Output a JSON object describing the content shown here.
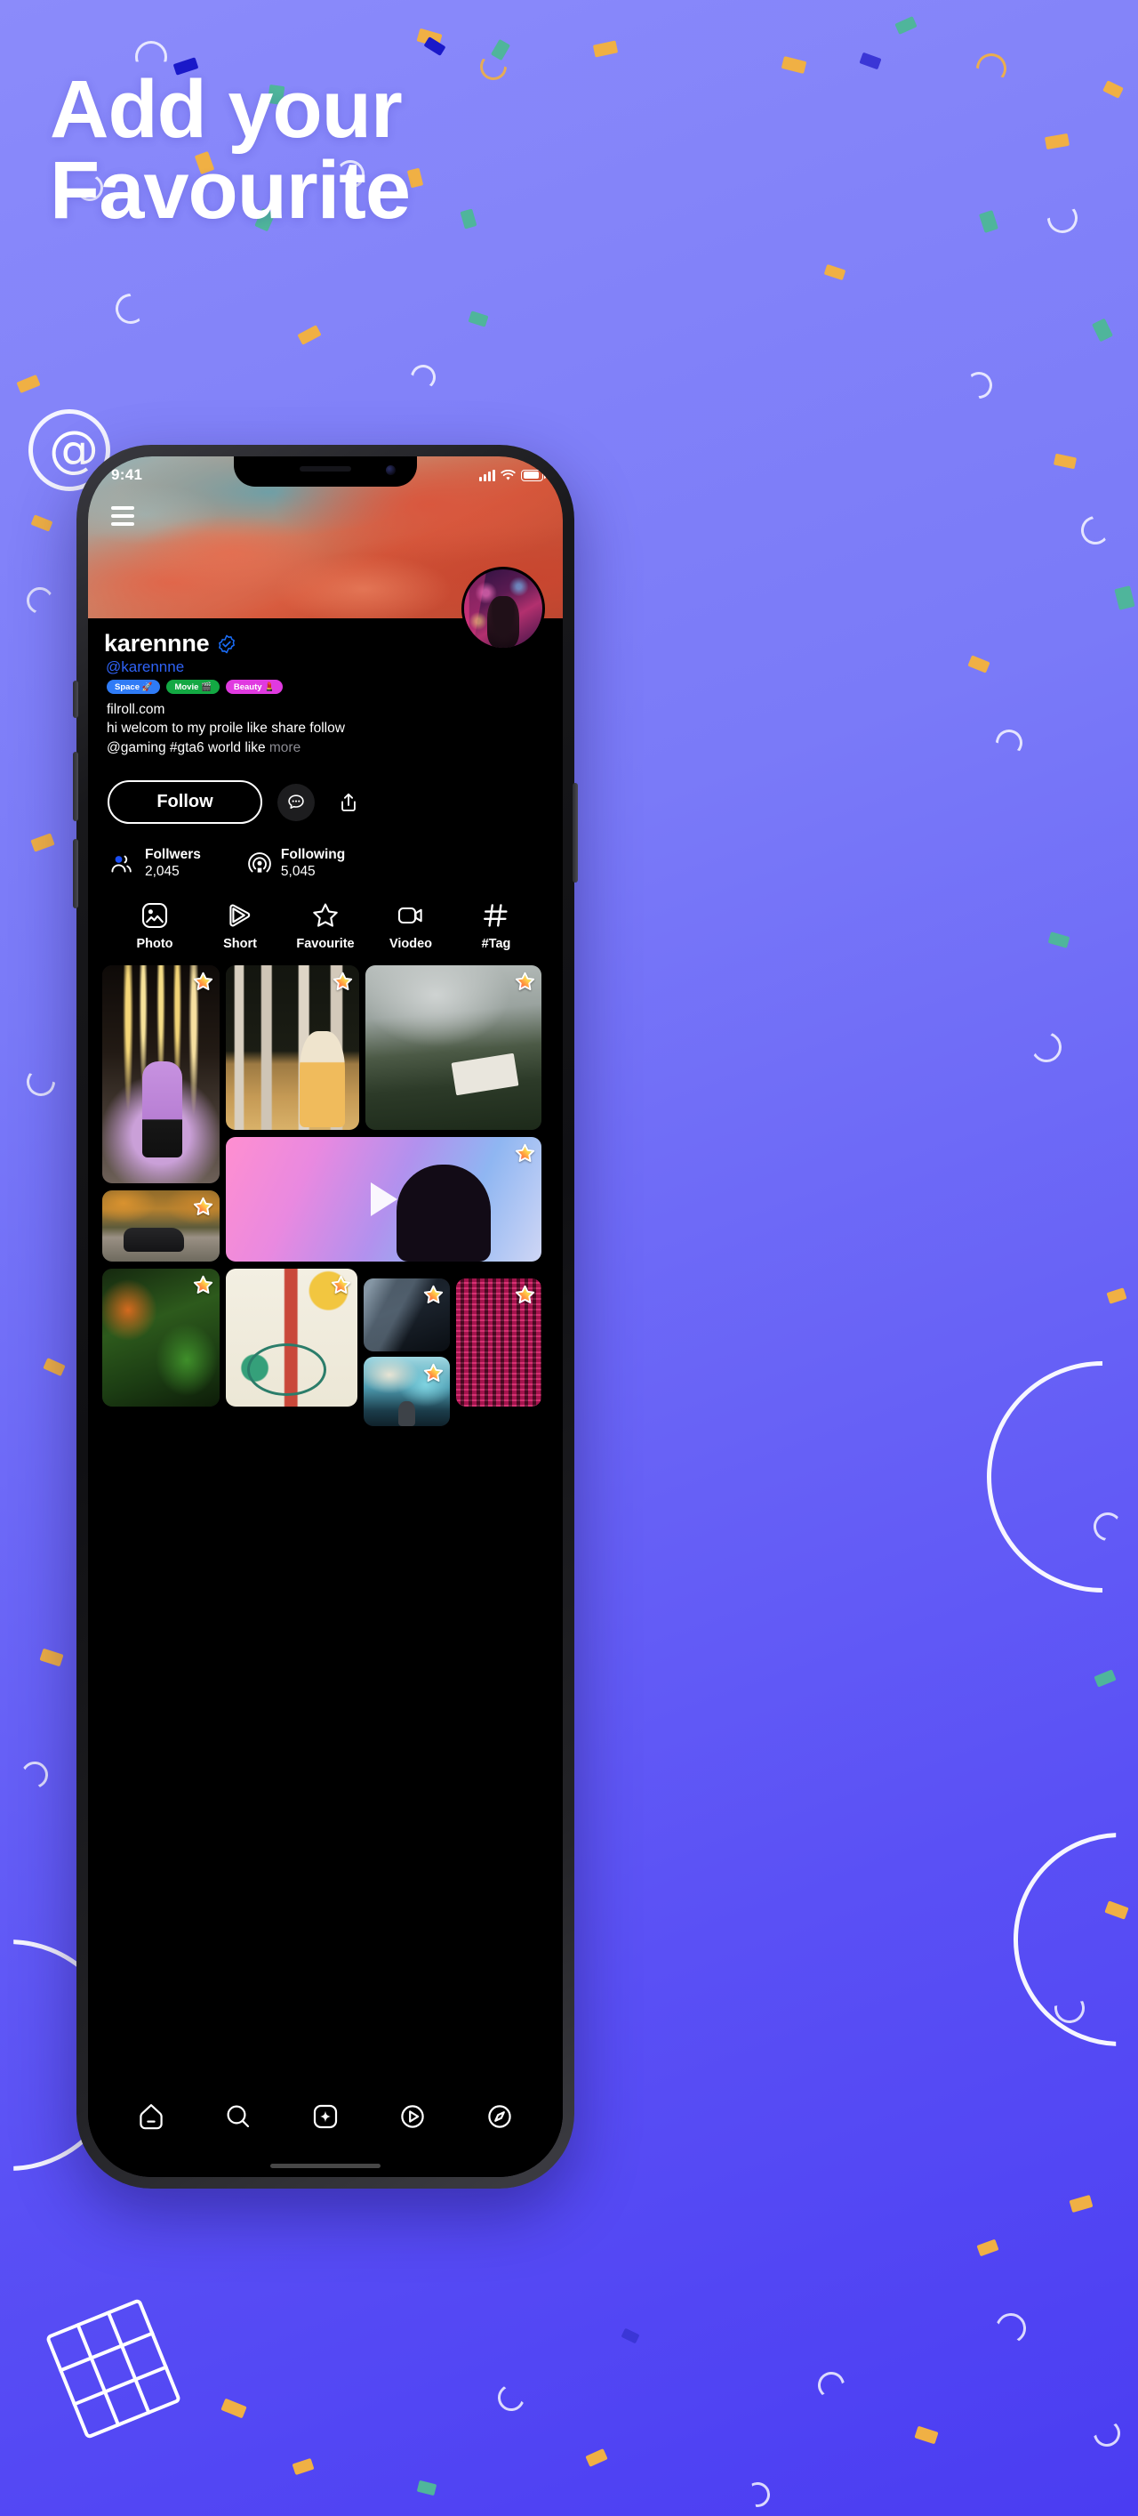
{
  "headline": {
    "text": "Add your\nFavourite"
  },
  "colors": {
    "bg_start": "#8b8bfa",
    "bg_end": "#4a3cf2",
    "accent_blue": "#2f63f7",
    "chip_space": "#2f7bf6",
    "chip_movie": "#13a843",
    "chip_beauty": "#e03ae0",
    "screen_bg": "#000000",
    "text_muted": "#8b8b92"
  },
  "status_bar": {
    "time": "9:41",
    "signal_icon": "cellular-bars-icon",
    "wifi_icon": "wifi-icon",
    "battery_icon": "battery-icon"
  },
  "header": {
    "menu_icon": "hamburger-menu-icon",
    "cover_image": "cover-photo-clouds",
    "avatar_image": "profile-avatar-photo"
  },
  "profile": {
    "display_name": "karennne",
    "verified_icon": "verified-badge-icon",
    "handle": "@karennne",
    "chips": [
      {
        "label": "Space 🚀",
        "style": "space"
      },
      {
        "label": "Movie 🎬",
        "style": "movie"
      },
      {
        "label": "Beauty 💄",
        "style": "beauty"
      }
    ],
    "website": "filroll.com",
    "bio_line_1": "hi welcom to my proile like share follow",
    "bio_line_2": "@gaming #gta6 world like",
    "more_label": "more"
  },
  "actions": {
    "follow_label": "Follow",
    "message_icon": "message-bubble-icon",
    "share_icon": "share-upload-icon"
  },
  "stats": [
    {
      "label": "Follwers",
      "value": "2,045",
      "icon": "followers-people-icon"
    },
    {
      "label": "Following",
      "value": "5,045",
      "icon": "following-broadcast-icon"
    }
  ],
  "tabs": [
    {
      "label": "Photo",
      "icon": "photo-image-icon"
    },
    {
      "label": "Short",
      "icon": "short-play-icon"
    },
    {
      "label": "Favourite",
      "icon": "star-outline-icon"
    },
    {
      "label": "Viodeo",
      "icon": "video-camera-icon"
    },
    {
      "label": "#Tag",
      "icon": "hashtag-icon"
    }
  ],
  "grid": {
    "star_badge_icon": "favourite-star-badge-icon",
    "play_icon": "play-triangle-icon",
    "items": [
      {
        "name": "post-lights-portrait",
        "art": "ph-lights",
        "starred": true,
        "video": false
      },
      {
        "name": "post-forest-woman",
        "art": "ph-forest",
        "starred": true,
        "video": false
      },
      {
        "name": "post-rock-paper",
        "art": "ph-rock",
        "starred": true,
        "video": false
      },
      {
        "name": "post-autumn-car",
        "art": "ph-car",
        "starred": true,
        "video": false
      },
      {
        "name": "post-gradient-video",
        "art": "ph-gradient",
        "starred": true,
        "video": true
      },
      {
        "name": "post-green-plants",
        "art": "ph-plants",
        "starred": true,
        "video": false
      },
      {
        "name": "post-art-bicycle",
        "art": "ph-art",
        "starred": true,
        "video": false
      },
      {
        "name": "post-dark-abstract",
        "art": "ph-dark",
        "starred": true,
        "video": false
      },
      {
        "name": "post-city-street",
        "art": "ph-street",
        "starred": true,
        "video": false
      },
      {
        "name": "post-red-building",
        "art": "ph-building",
        "starred": true,
        "video": false
      }
    ]
  },
  "bottom_nav": [
    {
      "name": "nav-home",
      "icon": "home-icon"
    },
    {
      "name": "nav-search",
      "icon": "search-icon"
    },
    {
      "name": "nav-create",
      "icon": "add-plus-square-icon"
    },
    {
      "name": "nav-reels",
      "icon": "play-circle-icon"
    },
    {
      "name": "nav-explore",
      "icon": "compass-icon"
    }
  ],
  "decor": {
    "at_symbol": "@",
    "ring_icon": "at-circle-decoration",
    "film_icon": "film-strip-decoration"
  }
}
